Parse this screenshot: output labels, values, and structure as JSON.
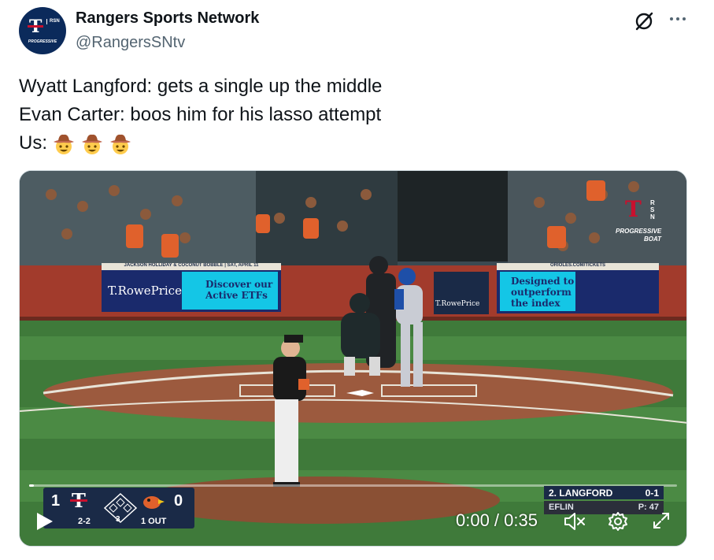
{
  "author": {
    "name": "Rangers Sports Network",
    "handle": "@RangersSNtv",
    "avatar_letter": "T",
    "avatar_rsn": "RSN",
    "avatar_tagline": "PROGRESSIVE"
  },
  "tweet": {
    "line1": "Wyatt Langford: gets a single up the middle",
    "line2": "Evan Carter: boos him for his lasso attempt",
    "line3": "Us:",
    "emoji": [
      "cowboy-face",
      "cowboy-face",
      "cowboy-face"
    ]
  },
  "video": {
    "overlay_logo_letter": "T",
    "overlay_logo_rsn": "RSN",
    "overlay_tagline": "PROGRESSIVE",
    "overlay_tagline2": "BOAT",
    "ads": {
      "left_brand": "T.RowePrice",
      "left_slogan1": "Discover our",
      "left_slogan2": "Active ETFs",
      "left_banner": "JACKSON HOLLIDAY & COCONUT BOBBLE | SAT, APRIL 11",
      "center_brand": "T.RowePrice",
      "right_slogan1": "Designed to",
      "right_slogan2": "outperform",
      "right_slogan3": "the index",
      "right_banner": "ORIOLES.COM/TICKETS"
    },
    "scorebug": {
      "away_score": "1",
      "home_score": "0",
      "count": "2-2",
      "inning": "3",
      "outs": "1 OUT"
    },
    "batter": {
      "name": "2. LANGFORD",
      "stat": "0-1",
      "pitcher": "EFLIN",
      "pitches": "P: 47"
    },
    "time": "0:00 / 0:35",
    "progress": 0.007,
    "colors": {
      "navy": "#1a2a47",
      "red": "#c8102e",
      "ad_cyan": "#14c6e6"
    }
  }
}
